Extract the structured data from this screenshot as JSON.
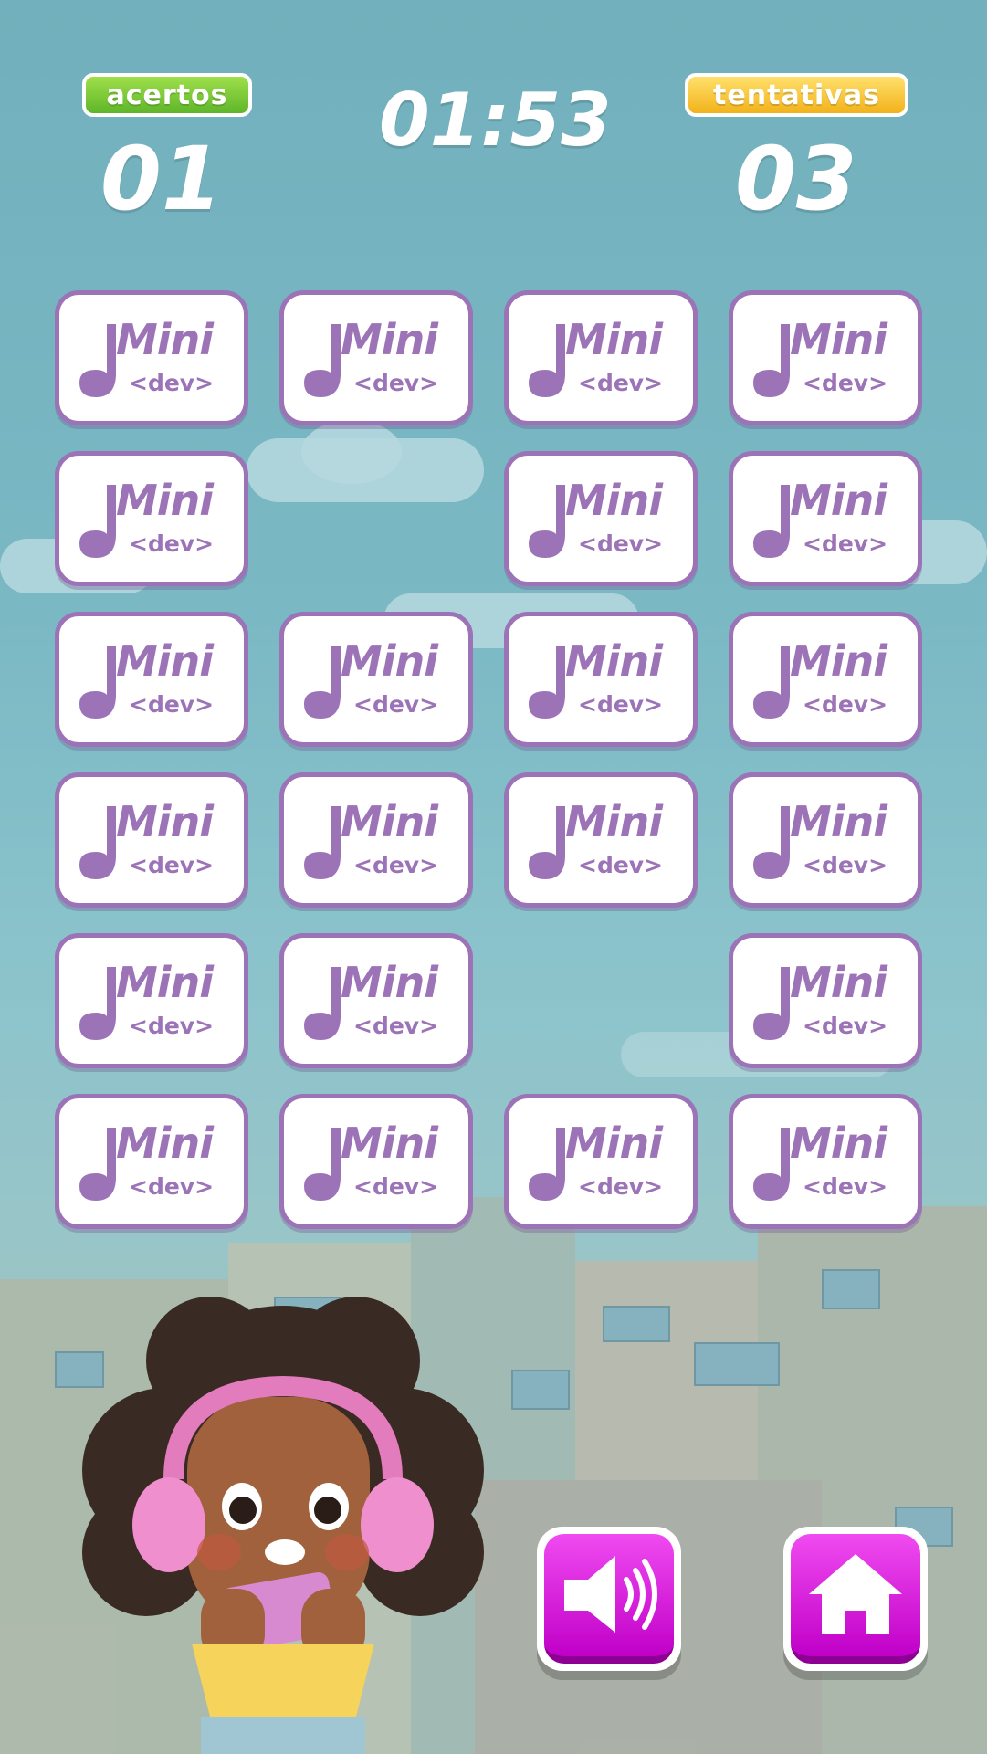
{
  "hud": {
    "hits_label": "acertos",
    "hits_value": "01",
    "timer": "01:53",
    "attempts_label": "tentativas",
    "attempts_value": "03"
  },
  "card_logo": {
    "word": "Mini",
    "sub": "<dev>"
  },
  "grid": {
    "rows": 6,
    "cols": 4,
    "cards": [
      [
        true,
        true,
        true,
        true
      ],
      [
        true,
        false,
        true,
        true
      ],
      [
        true,
        true,
        true,
        true
      ],
      [
        true,
        true,
        true,
        true
      ],
      [
        true,
        true,
        false,
        true
      ],
      [
        true,
        true,
        true,
        true
      ]
    ]
  },
  "buttons": {
    "sound": "speaker-icon",
    "home": "home-icon"
  },
  "colors": {
    "card_border": "#9b73b6",
    "button": "#e02ee0",
    "hits_badge": "#6cc234",
    "attempts_badge": "#f5c12a"
  }
}
